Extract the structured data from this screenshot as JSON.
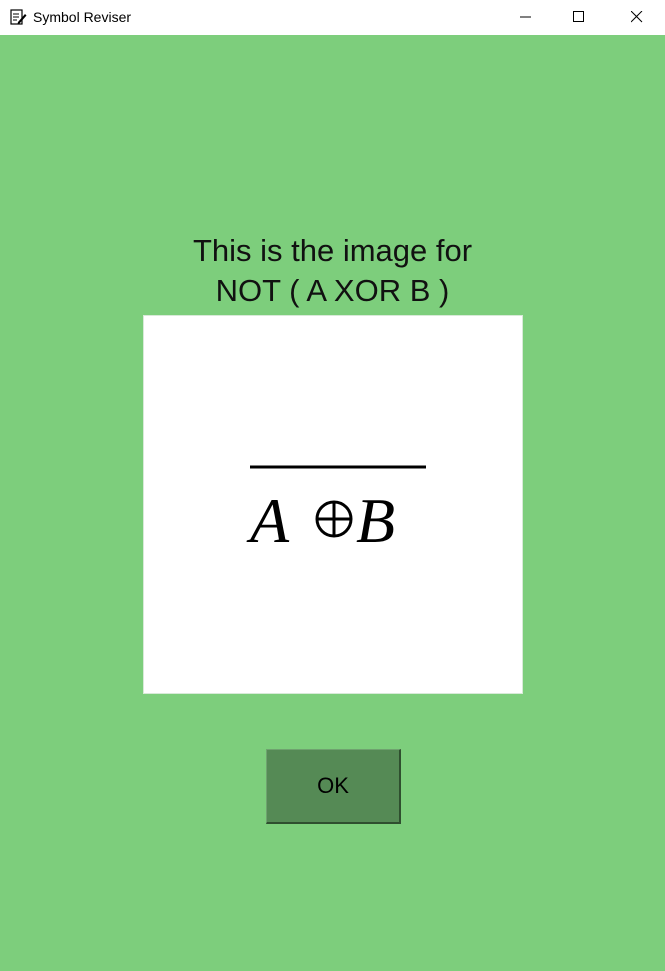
{
  "window": {
    "title": "Symbol Reviser",
    "icon": "notepad-edit-icon",
    "controls": [
      "minimize-icon",
      "maximize-icon",
      "close-icon"
    ]
  },
  "main": {
    "caption_line1": "This is the image for",
    "caption_line2": "NOT ( A XOR B )",
    "symbol_image": {
      "left_operand": "A",
      "operator": "⊕",
      "right_operand": "B",
      "overbar": true
    },
    "ok_label": "OK"
  },
  "colors": {
    "background": "#7dce7c",
    "ok_button": "#558a55",
    "image_background": "#ffffff"
  }
}
